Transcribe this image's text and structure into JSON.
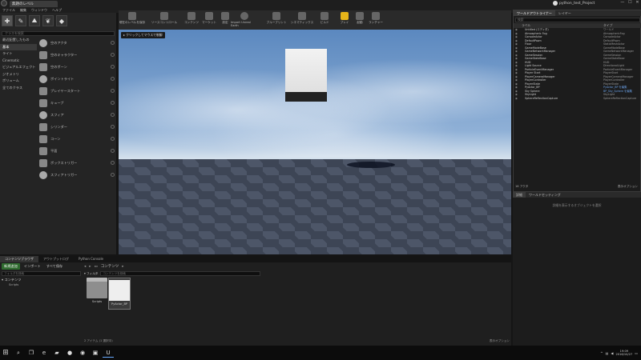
{
  "window": {
    "tab_title": "無題のレベル",
    "project_name": "python_test_Project",
    "controls": [
      "—",
      "☐",
      "✕"
    ]
  },
  "menu": [
    "ファイル",
    "編集",
    "ウィンドウ",
    "ヘルプ"
  ],
  "modes": {
    "tab_label": "モード",
    "icons": [
      "place-mode-icon",
      "paint-mode-icon",
      "landscape-mode-icon",
      "foliage-mode-icon",
      "geometry-mode-icon"
    ]
  },
  "place": {
    "search_placeholder": "クラスを検索",
    "categories": [
      "最近配置したもの",
      "基本",
      "ライト",
      "Cinematic",
      "ビジュアルエフェクト",
      "ジオメトリ",
      "ボリューム",
      "全てのクラス"
    ],
    "selected_category": "基本",
    "items": [
      "空のアクタ",
      "空のキャラクター",
      "空のポーン",
      "ポイントライト",
      "プレイヤースタート",
      "キューブ",
      "スフィア",
      "シリンダー",
      "コーン",
      "平面",
      "ボックストリガー",
      "スフィアトリガー"
    ]
  },
  "toolbar": {
    "buttons": [
      "現在のレベルを保存",
      "ソースコントロール",
      "コンテンツ",
      "マーケット",
      "設定",
      "Import Unreal Earth",
      "ブループリント",
      "シネマティックス",
      "ビルド",
      "プレイ",
      "起動",
      "ランチャー"
    ]
  },
  "viewport": {
    "hint": "▸ クリックしてマウスで制御"
  },
  "outliner": {
    "tabs": [
      "ワールドアウトライナー",
      "レイヤー"
    ],
    "search_placeholder": "検索",
    "col_label": "ラベル",
    "col_type": "タイプ",
    "rows": [
      {
        "name": "Untitled (エディタ)",
        "type": "ワールド"
      },
      {
        "name": "Atmospheric Fog",
        "type": "AtmosphericFog"
      },
      {
        "name": "ConsoleActor",
        "type": "ConsoleActor"
      },
      {
        "name": "DefaultPawn",
        "type": "DefaultPawn"
      },
      {
        "name": "Floor",
        "type": "StaticMeshActor"
      },
      {
        "name": "GameModeBase",
        "type": "GameModeBase"
      },
      {
        "name": "GameNetworkManager",
        "type": "GameNetworkManager"
      },
      {
        "name": "GameSession",
        "type": "GameSession"
      },
      {
        "name": "GameStateBase",
        "type": "GameStateBase"
      },
      {
        "name": "HUD",
        "type": "HUD"
      },
      {
        "name": "Light Source",
        "type": "DirectionalLight"
      },
      {
        "name": "ParticleEventManager",
        "type": "ParticleEventManager"
      },
      {
        "name": "Player Start",
        "type": "PlayerStart"
      },
      {
        "name": "PlayerCameraManager",
        "type": "PlayerCameraManager"
      },
      {
        "name": "PlayerController",
        "type": "PlayerController"
      },
      {
        "name": "PlayerState",
        "type": "PlayerState"
      },
      {
        "name": "PyActor_BP",
        "type": "PyActor_BP を編集",
        "link": true
      },
      {
        "name": "Sky Sphere",
        "type": "BP_Sky_Sphere を編集",
        "link": true
      },
      {
        "name": "SkyLight",
        "type": "SkyLight"
      },
      {
        "name": "SphereReflectionCapture",
        "type": "SphereReflectionCapture"
      }
    ],
    "count": "18 アクタ",
    "view_options": "表示オプション"
  },
  "details": {
    "tabs": [
      "詳細",
      "ワールドセッティング"
    ],
    "hint": "詳細を表示するオブジェクトを選択"
  },
  "content_browser": {
    "tabs": [
      "コンテンツブラウザ",
      "アウトプットログ",
      "Python Console"
    ],
    "add_new": "新規追加",
    "import": "インポート",
    "save_all": "すべて保存",
    "left_search_placeholder": "フォルダを検索",
    "tree_root": "コンテンツ",
    "tree_child": "Scripts",
    "path": "コンテンツ",
    "filters": "フィルタ",
    "search_placeholder": "コンテンツを検索",
    "assets": [
      {
        "name": "Scripts",
        "kind": "folder"
      },
      {
        "name": "PyActor_BP",
        "kind": "blueprint"
      }
    ],
    "status": "2 アイテム (1 選択中)",
    "view_options": "表示オプション"
  },
  "taskbar": {
    "start_icon": "windows-start-icon",
    "apps": [
      "search-icon",
      "task-view-icon",
      "edge-icon",
      "explorer-icon",
      "firefox-icon",
      "chrome-icon",
      "terminal-icon",
      "unreal-icon"
    ],
    "time": "19:09",
    "date": "2016/10/27"
  },
  "colors": {
    "play_button": "#e6b419",
    "add_new_button": "#2f6b2f",
    "link_text": "#6aa0e6"
  }
}
